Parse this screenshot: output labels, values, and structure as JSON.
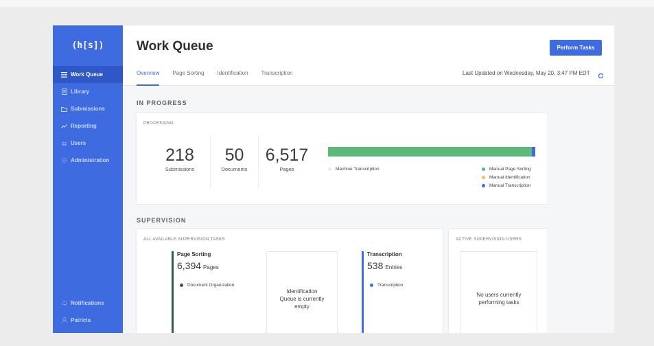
{
  "app": {
    "logo": "(h[s])"
  },
  "sidebar": {
    "items": [
      {
        "label": "Work Queue",
        "icon": "hamburger-icon"
      },
      {
        "label": "Library",
        "icon": "book-icon"
      },
      {
        "label": "Submissions",
        "icon": "folder-icon"
      },
      {
        "label": "Reporting",
        "icon": "trend-icon"
      },
      {
        "label": "Users",
        "icon": "users-icon"
      },
      {
        "label": "Administration",
        "icon": "gear-icon"
      }
    ],
    "bottom": [
      {
        "label": "Notifications",
        "icon": "bell-icon"
      },
      {
        "label": "Patricia",
        "icon": "user-icon"
      }
    ]
  },
  "header": {
    "title": "Work Queue",
    "perform_button": "Perform Tasks",
    "tabs": [
      "Overview",
      "Page Sorting",
      "Identification",
      "Transcription"
    ],
    "last_updated": "Last Updated on Wednesday, May 20, 3:47 PM EDT"
  },
  "in_progress": {
    "section_title": "IN PROGRESS",
    "card_label": "PROCESSING",
    "stats": [
      {
        "value": "218",
        "label": "Submissions"
      },
      {
        "value": "50",
        "label": "Documents"
      },
      {
        "value": "6,517",
        "label": "Pages"
      }
    ],
    "progress": {
      "machine_transcription_fraction": 0.0,
      "manual_page_sorting_fraction": 0.985,
      "manual_identification_fraction": 0.0,
      "manual_transcription_fraction": 0.015
    },
    "legend": {
      "machine": "Machine Transcription",
      "page_sorting": "Manual Page Sorting",
      "identification": "Manual Identification",
      "transcription": "Manual Transcription"
    }
  },
  "supervision": {
    "section_title": "SUPERVISION",
    "tasks_card_label": "ALL AVAILABLE SUPERVISION TASKS",
    "users_card_label": "ACTIVE SUPERVISION USERS",
    "page_sorting": {
      "title": "Page Sorting",
      "count": "6,394",
      "unit": "Pages",
      "legend": "Document Organization"
    },
    "identification": {
      "empty_line1": "Identification",
      "empty_line2": "Queue is currently",
      "empty_line3": "empty"
    },
    "transcription": {
      "title": "Transcription",
      "count": "538",
      "unit": "Entries",
      "legend": "Transcription"
    },
    "users_empty_line1": "No users currently",
    "users_empty_line2": "performing tasks"
  },
  "colors": {
    "brand": "#3f6be0",
    "page_sorting_green": "#5cb97a",
    "identification_yellow": "#f2c14e",
    "transcription_blue": "#3f6be0",
    "document_organization": "#2f5d4a"
  }
}
